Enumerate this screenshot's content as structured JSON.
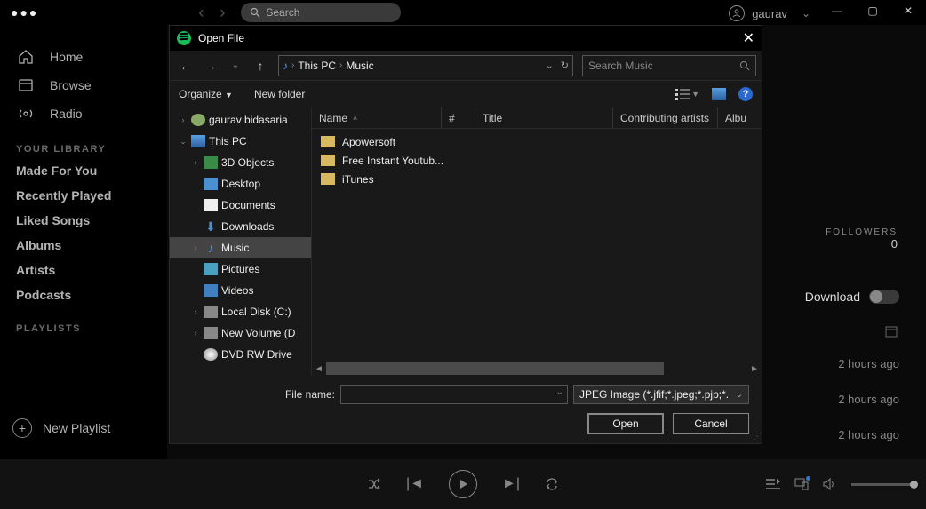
{
  "topbar": {
    "search_placeholder": "Search",
    "username": "gaurav"
  },
  "sidebar": {
    "nav": [
      {
        "label": "Home"
      },
      {
        "label": "Browse"
      },
      {
        "label": "Radio"
      }
    ],
    "library_header": "YOUR LIBRARY",
    "library": [
      "Made For You",
      "Recently Played",
      "Liked Songs",
      "Albums",
      "Artists",
      "Podcasts"
    ],
    "playlists_header": "PLAYLISTS",
    "new_playlist": "New Playlist"
  },
  "main": {
    "followers_label": "FOLLOWERS",
    "followers_count": "0",
    "download_label": "Download",
    "ago_rows": [
      "2 hours ago",
      "2 hours ago",
      "2 hours ago"
    ]
  },
  "dialog": {
    "title": "Open File",
    "breadcrumb": {
      "root": "This PC",
      "folder": "Music"
    },
    "search_placeholder": "Search Music",
    "organize": "Organize",
    "new_folder": "New folder",
    "tree": [
      {
        "label": "gaurav bidasaria",
        "level": 1,
        "twist": "›",
        "icon": "user"
      },
      {
        "label": "This PC",
        "level": 1,
        "twist": "⌄",
        "icon": "pc"
      },
      {
        "label": "3D Objects",
        "level": 2,
        "twist": "›",
        "icon": "folder3d"
      },
      {
        "label": "Desktop",
        "level": 2,
        "twist": "",
        "icon": "desktop"
      },
      {
        "label": "Documents",
        "level": 2,
        "twist": "",
        "icon": "docs"
      },
      {
        "label": "Downloads",
        "level": 2,
        "twist": "",
        "icon": "downloads"
      },
      {
        "label": "Music",
        "level": 2,
        "twist": "›",
        "icon": "music",
        "selected": true
      },
      {
        "label": "Pictures",
        "level": 2,
        "twist": "",
        "icon": "pictures"
      },
      {
        "label": "Videos",
        "level": 2,
        "twist": "",
        "icon": "videos"
      },
      {
        "label": "Local Disk (C:)",
        "level": 2,
        "twist": "›",
        "icon": "disk"
      },
      {
        "label": "New Volume (D",
        "level": 2,
        "twist": "›",
        "icon": "disk"
      },
      {
        "label": "DVD RW Drive",
        "level": 2,
        "twist": "",
        "icon": "dvd"
      }
    ],
    "columns": [
      "Name",
      "#",
      "Title",
      "Contributing artists",
      "Albu"
    ],
    "files": [
      "Apowersoft",
      "Free Instant Youtub...",
      "iTunes"
    ],
    "file_name_label": "File name:",
    "file_type": "JPEG Image (*.jfif;*.jpeg;*.pjp;*.",
    "open_btn": "Open",
    "cancel_btn": "Cancel"
  }
}
